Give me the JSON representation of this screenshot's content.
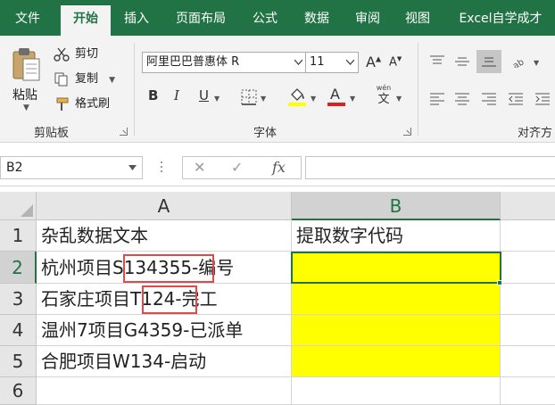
{
  "tabs": [
    "文件",
    "开始",
    "插入",
    "页面布局",
    "公式",
    "数据",
    "审阅",
    "视图",
    "Excel自学成才"
  ],
  "ribbon": {
    "clipboard": {
      "paste": "粘贴",
      "cut": "剪切",
      "copy": "复制",
      "format_painter": "格式刷",
      "group_label": "剪贴板"
    },
    "font": {
      "font_name": "阿里巴巴普惠体 R",
      "font_size": "11",
      "grow": "A",
      "shrink": "A",
      "bold": "B",
      "italic": "I",
      "underline": "U",
      "font_color": "A",
      "phonetic": "wén",
      "phonetic_char": "文",
      "group_label": "字体"
    },
    "alignment": {
      "group_label": "对齐方"
    }
  },
  "formula_bar": {
    "name_box": "B2",
    "cancel": "✕",
    "enter": "✓",
    "fx": "fx",
    "formula": ""
  },
  "grid": {
    "columns": [
      "A",
      "B"
    ],
    "rows": [
      "1",
      "2",
      "3",
      "4",
      "5",
      "6"
    ],
    "cells": [
      [
        "杂乱数据文本",
        "提取数字代码"
      ],
      [
        "杭州项目S134355-编号",
        ""
      ],
      [
        "石家庄项目T124-完工",
        ""
      ],
      [
        "温州7项目G4359-已派单",
        ""
      ],
      [
        "合肥项目W134-启动",
        ""
      ],
      [
        "",
        ""
      ]
    ],
    "selected_cell": "B2",
    "highlight_color": "#ffff00",
    "accent_color": "#217346",
    "annotation_color": "#e04a4a"
  }
}
